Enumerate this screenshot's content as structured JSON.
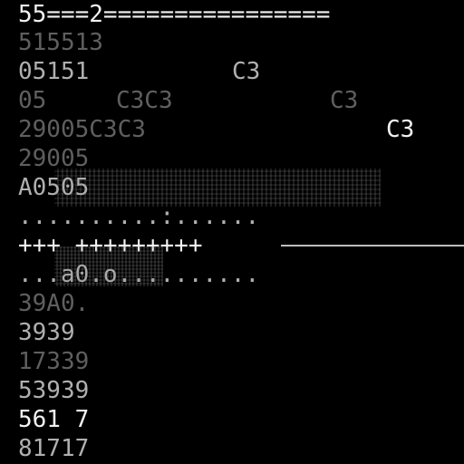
{
  "terminal": {
    "lines": [
      {
        "text": "55===2================",
        "tone": "bright"
      },
      {
        "text": "515513",
        "tone": "dim"
      },
      {
        "text": "05151",
        "tone": "mid"
      },
      {
        "text": "05",
        "tone": "dim"
      },
      {
        "text": "29005C3C3",
        "tone": "dim"
      },
      {
        "text": "29005",
        "tone": "dim"
      },
      {
        "text": "A0505",
        "tone": "mid"
      },
      {
        "text": "..........:......",
        "tone": "mid"
      },
      {
        "text": "+++ +++++++++",
        "tone": "bright"
      },
      {
        "text": "...a0.o..........",
        "tone": "mid"
      },
      {
        "text": "39A0.",
        "tone": "dim"
      },
      {
        "text": "3939",
        "tone": "mid"
      },
      {
        "text": "17339",
        "tone": "dim"
      },
      {
        "text": "53939",
        "tone": "mid"
      },
      {
        "text": "561 7",
        "tone": "bright"
      },
      {
        "text": "81717",
        "tone": "mid"
      }
    ],
    "floating": [
      {
        "text": "C3",
        "tone": "mid"
      },
      {
        "text": "C3C3",
        "tone": "dim"
      },
      {
        "text": "C3",
        "tone": "dim"
      },
      {
        "text": "C3",
        "tone": "bright"
      }
    ]
  }
}
